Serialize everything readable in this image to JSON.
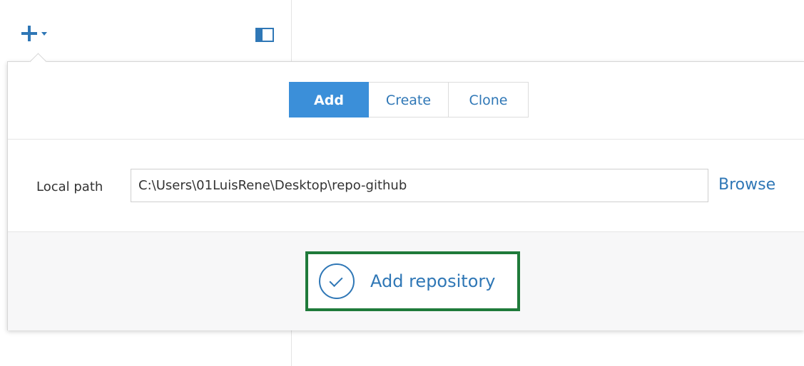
{
  "toolbar": {
    "add_menu_icon": "plus-icon",
    "add_menu_caret_icon": "caret-down-icon",
    "sidebar_toggle_icon": "sidebar-toggle-icon"
  },
  "popover": {
    "tabs": [
      {
        "label": "Add",
        "active": true
      },
      {
        "label": "Create",
        "active": false
      },
      {
        "label": "Clone",
        "active": false
      }
    ],
    "local_path": {
      "label": "Local path",
      "value": "C:\\Users\\01LuisRene\\Desktop\\repo-github",
      "browse_label": "Browse"
    },
    "submit": {
      "label": "Add repository",
      "icon": "check-circle-icon"
    }
  },
  "colors": {
    "accent": "#3b8fd9",
    "link": "#2f77b6",
    "highlight_border": "#1f7a3a"
  }
}
